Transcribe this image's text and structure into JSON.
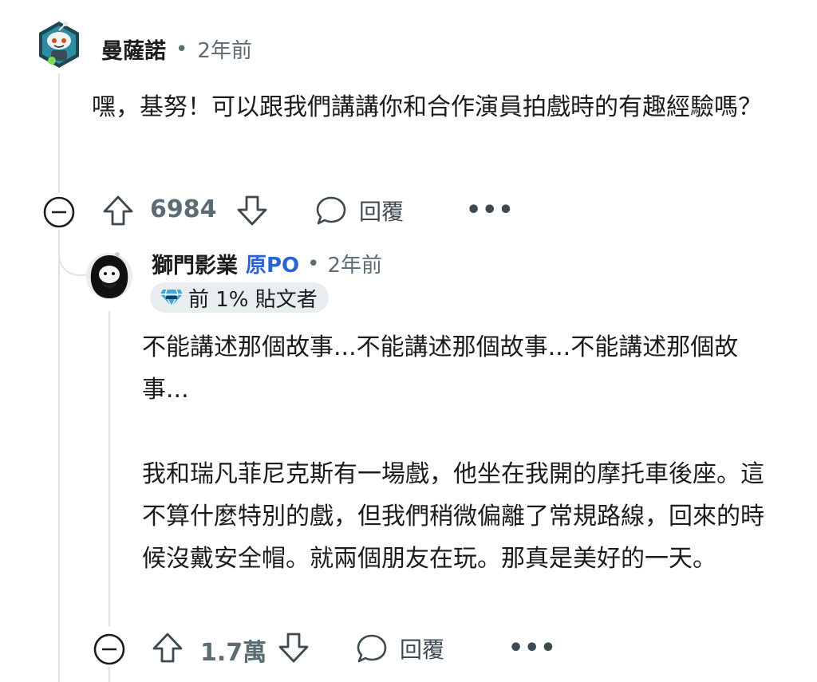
{
  "comment": {
    "author": "曼薩諾",
    "age": "2年前",
    "body": "嘿，基努！可以跟我們講講你和合作演員拍戲時的有趣經驗嗎？",
    "votes": "6984",
    "reply_label": "回覆"
  },
  "reply": {
    "author": "獅門影業",
    "op_label": "原PO",
    "age": "2年前",
    "badge": "前 1% 貼文者",
    "paragraphs": [
      "不能講述那個故事...不能講述那個故事...不能講述那個故事...",
      "我和瑞凡菲尼克斯有一場戲，他坐在我開的摩托車後座。這不算什麼特別的戲，但我們稍微偏離了常規路線，回來的時候沒戴安全帽。就兩個朋友在玩。那真是美好的一天。"
    ],
    "votes": "1.7萬",
    "reply_label": "回覆"
  },
  "separator": "•",
  "more": "•••",
  "icons": [
    "robot-avatar",
    "collapse-icon",
    "upvote-icon",
    "downvote-icon",
    "comment-bubble-icon",
    "more-icon",
    "diamond-badge-icon"
  ]
}
